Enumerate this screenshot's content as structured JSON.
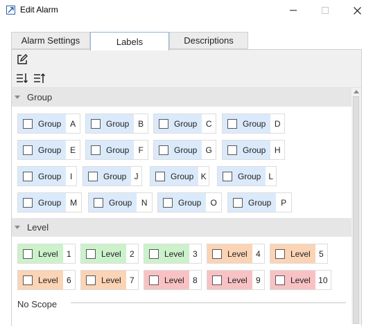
{
  "window": {
    "title": "Edit Alarm",
    "controls": {
      "minimize": "minimize",
      "maximize": "maximize",
      "close": "close"
    }
  },
  "tabs": [
    {
      "label": "Alarm Settings",
      "active": false
    },
    {
      "label": "Labels",
      "active": true
    },
    {
      "label": "Descriptions",
      "active": false
    }
  ],
  "toolbar": {
    "edit_icon": "edit-icon",
    "sort_asc_icon": "sort-ascending-icon",
    "sort_desc_icon": "sort-descending-icon"
  },
  "colors": {
    "group_chip": "#dbeafb",
    "level_green": "#ccf2cc",
    "level_orange": "#fbd3b5",
    "level_red": "#f8c2c4"
  },
  "group_section": {
    "title": "Group",
    "chip_label": "Group",
    "items": [
      "A",
      "B",
      "C",
      "D",
      "E",
      "F",
      "G",
      "H",
      "I",
      "J",
      "K",
      "L",
      "M",
      "N",
      "O",
      "P"
    ]
  },
  "level_section": {
    "title": "Level",
    "chip_label": "Level",
    "items": [
      {
        "value": "1",
        "color": "#ccf2cc"
      },
      {
        "value": "2",
        "color": "#ccf2cc"
      },
      {
        "value": "3",
        "color": "#ccf2cc"
      },
      {
        "value": "4",
        "color": "#fbd3b5"
      },
      {
        "value": "5",
        "color": "#fbd3b5"
      },
      {
        "value": "6",
        "color": "#fbd3b5"
      },
      {
        "value": "7",
        "color": "#fbd3b5"
      },
      {
        "value": "8",
        "color": "#f8c2c4"
      },
      {
        "value": "9",
        "color": "#f8c2c4"
      },
      {
        "value": "10",
        "color": "#f8c2c4"
      }
    ]
  },
  "no_scope": {
    "label": "No Scope"
  }
}
